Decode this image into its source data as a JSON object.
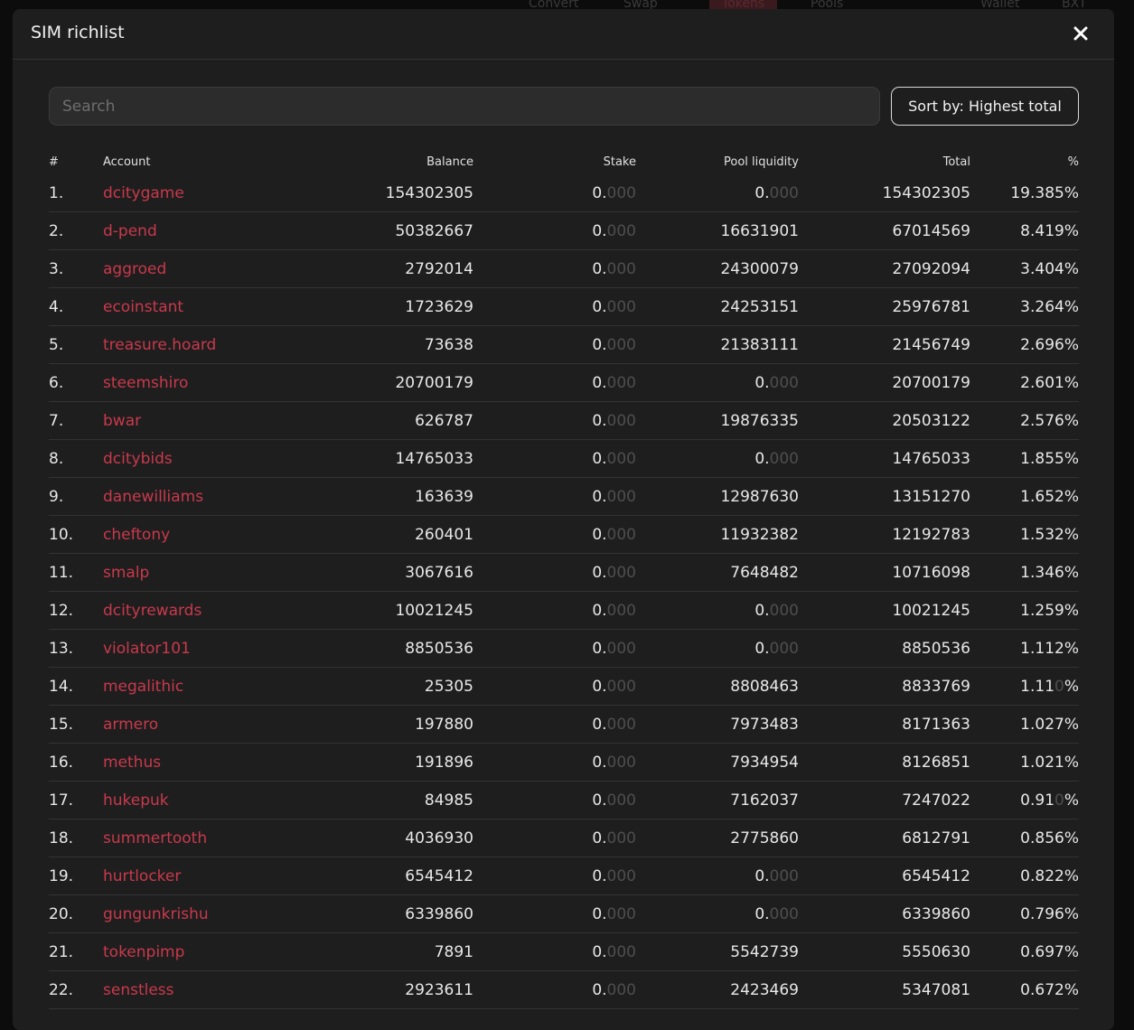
{
  "backdrop_nav": [
    "Convert",
    "Swap",
    "Tokens",
    "Pools",
    "Wallet",
    "BXT"
  ],
  "modal": {
    "title": "SIM richlist",
    "close_icon": "close-icon"
  },
  "search": {
    "placeholder": "Search",
    "value": ""
  },
  "sort_button_label": "Sort by: Highest total",
  "columns": [
    "#",
    "Account",
    "Balance",
    "Stake",
    "Pool liquidity",
    "Total",
    "%"
  ],
  "colors": {
    "link": "#c9394c",
    "modal_bg": "#1e1e1e",
    "dim_digits": "#4e4e4e"
  },
  "rows": [
    {
      "rank": "1.",
      "account": "dcitygame",
      "balance": "154302305",
      "stake_int": "0.",
      "stake_dec": "000",
      "pool_int": "0.",
      "pool_dec": "000",
      "total": "154302305",
      "pct_main": "19.385",
      "pct_dim": "",
      "pct_sign": "%"
    },
    {
      "rank": "2.",
      "account": "d-pend",
      "balance": "50382667",
      "stake_int": "0.",
      "stake_dec": "000",
      "pool_int": "16631901",
      "pool_dec": "",
      "total": "67014569",
      "pct_main": "8.419",
      "pct_dim": "",
      "pct_sign": "%"
    },
    {
      "rank": "3.",
      "account": "aggroed",
      "balance": "2792014",
      "stake_int": "0.",
      "stake_dec": "000",
      "pool_int": "24300079",
      "pool_dec": "",
      "total": "27092094",
      "pct_main": "3.404",
      "pct_dim": "",
      "pct_sign": "%"
    },
    {
      "rank": "4.",
      "account": "ecoinstant",
      "balance": "1723629",
      "stake_int": "0.",
      "stake_dec": "000",
      "pool_int": "24253151",
      "pool_dec": "",
      "total": "25976781",
      "pct_main": "3.264",
      "pct_dim": "",
      "pct_sign": "%"
    },
    {
      "rank": "5.",
      "account": "treasure.hoard",
      "balance": "73638",
      "stake_int": "0.",
      "stake_dec": "000",
      "pool_int": "21383111",
      "pool_dec": "",
      "total": "21456749",
      "pct_main": "2.696",
      "pct_dim": "",
      "pct_sign": "%"
    },
    {
      "rank": "6.",
      "account": "steemshiro",
      "balance": "20700179",
      "stake_int": "0.",
      "stake_dec": "000",
      "pool_int": "0.",
      "pool_dec": "000",
      "total": "20700179",
      "pct_main": "2.601",
      "pct_dim": "",
      "pct_sign": "%"
    },
    {
      "rank": "7.",
      "account": "bwar",
      "balance": "626787",
      "stake_int": "0.",
      "stake_dec": "000",
      "pool_int": "19876335",
      "pool_dec": "",
      "total": "20503122",
      "pct_main": "2.576",
      "pct_dim": "",
      "pct_sign": "%"
    },
    {
      "rank": "8.",
      "account": "dcitybids",
      "balance": "14765033",
      "stake_int": "0.",
      "stake_dec": "000",
      "pool_int": "0.",
      "pool_dec": "000",
      "total": "14765033",
      "pct_main": "1.855",
      "pct_dim": "",
      "pct_sign": "%"
    },
    {
      "rank": "9.",
      "account": "danewilliams",
      "balance": "163639",
      "stake_int": "0.",
      "stake_dec": "000",
      "pool_int": "12987630",
      "pool_dec": "",
      "total": "13151270",
      "pct_main": "1.652",
      "pct_dim": "",
      "pct_sign": "%"
    },
    {
      "rank": "10.",
      "account": "cheftony",
      "balance": "260401",
      "stake_int": "0.",
      "stake_dec": "000",
      "pool_int": "11932382",
      "pool_dec": "",
      "total": "12192783",
      "pct_main": "1.532",
      "pct_dim": "",
      "pct_sign": "%"
    },
    {
      "rank": "11.",
      "account": "smalp",
      "balance": "3067616",
      "stake_int": "0.",
      "stake_dec": "000",
      "pool_int": "7648482",
      "pool_dec": "",
      "total": "10716098",
      "pct_main": "1.346",
      "pct_dim": "",
      "pct_sign": "%"
    },
    {
      "rank": "12.",
      "account": "dcityrewards",
      "balance": "10021245",
      "stake_int": "0.",
      "stake_dec": "000",
      "pool_int": "0.",
      "pool_dec": "000",
      "total": "10021245",
      "pct_main": "1.259",
      "pct_dim": "",
      "pct_sign": "%"
    },
    {
      "rank": "13.",
      "account": "violator101",
      "balance": "8850536",
      "stake_int": "0.",
      "stake_dec": "000",
      "pool_int": "0.",
      "pool_dec": "000",
      "total": "8850536",
      "pct_main": "1.112",
      "pct_dim": "",
      "pct_sign": "%"
    },
    {
      "rank": "14.",
      "account": "megalithic",
      "balance": "25305",
      "stake_int": "0.",
      "stake_dec": "000",
      "pool_int": "8808463",
      "pool_dec": "",
      "total": "8833769",
      "pct_main": "1.11",
      "pct_dim": "0",
      "pct_sign": "%"
    },
    {
      "rank": "15.",
      "account": "armero",
      "balance": "197880",
      "stake_int": "0.",
      "stake_dec": "000",
      "pool_int": "7973483",
      "pool_dec": "",
      "total": "8171363",
      "pct_main": "1.027",
      "pct_dim": "",
      "pct_sign": "%"
    },
    {
      "rank": "16.",
      "account": "methus",
      "balance": "191896",
      "stake_int": "0.",
      "stake_dec": "000",
      "pool_int": "7934954",
      "pool_dec": "",
      "total": "8126851",
      "pct_main": "1.021",
      "pct_dim": "",
      "pct_sign": "%"
    },
    {
      "rank": "17.",
      "account": "hukepuk",
      "balance": "84985",
      "stake_int": "0.",
      "stake_dec": "000",
      "pool_int": "7162037",
      "pool_dec": "",
      "total": "7247022",
      "pct_main": "0.91",
      "pct_dim": "0",
      "pct_sign": "%"
    },
    {
      "rank": "18.",
      "account": "summertooth",
      "balance": "4036930",
      "stake_int": "0.",
      "stake_dec": "000",
      "pool_int": "2775860",
      "pool_dec": "",
      "total": "6812791",
      "pct_main": "0.856",
      "pct_dim": "",
      "pct_sign": "%"
    },
    {
      "rank": "19.",
      "account": "hurtlocker",
      "balance": "6545412",
      "stake_int": "0.",
      "stake_dec": "000",
      "pool_int": "0.",
      "pool_dec": "000",
      "total": "6545412",
      "pct_main": "0.822",
      "pct_dim": "",
      "pct_sign": "%"
    },
    {
      "rank": "20.",
      "account": "gungunkrishu",
      "balance": "6339860",
      "stake_int": "0.",
      "stake_dec": "000",
      "pool_int": "0.",
      "pool_dec": "000",
      "total": "6339860",
      "pct_main": "0.796",
      "pct_dim": "",
      "pct_sign": "%"
    },
    {
      "rank": "21.",
      "account": "tokenpimp",
      "balance": "7891",
      "stake_int": "0.",
      "stake_dec": "000",
      "pool_int": "5542739",
      "pool_dec": "",
      "total": "5550630",
      "pct_main": "0.697",
      "pct_dim": "",
      "pct_sign": "%"
    },
    {
      "rank": "22.",
      "account": "senstless",
      "balance": "2923611",
      "stake_int": "0.",
      "stake_dec": "000",
      "pool_int": "2423469",
      "pool_dec": "",
      "total": "5347081",
      "pct_main": "0.672",
      "pct_dim": "",
      "pct_sign": "%"
    }
  ]
}
